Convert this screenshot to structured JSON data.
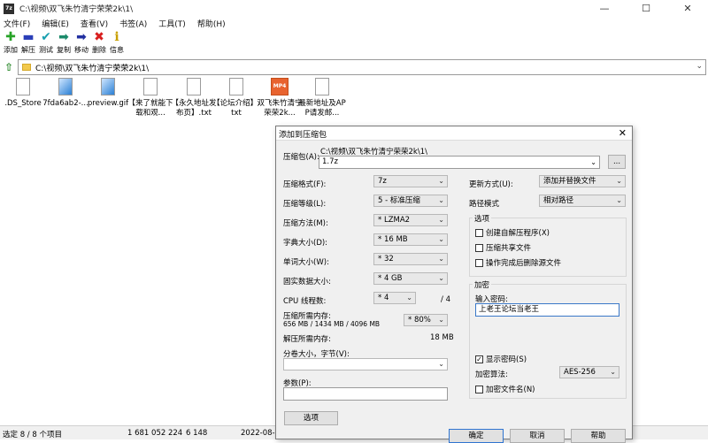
{
  "window": {
    "title": "C:\\视频\\双飞朱竹清宁荣荣2k\\1\\",
    "app_icon": "7z",
    "controls": {
      "minimize": "—",
      "maximize": "☐",
      "close": "✕"
    }
  },
  "menu": [
    "文件(F)",
    "编辑(E)",
    "查看(V)",
    "书签(A)",
    "工具(T)",
    "帮助(H)"
  ],
  "toolbar": [
    {
      "label": "添加",
      "icon": "add-icon",
      "glyph": "✚",
      "color": "#27a327"
    },
    {
      "label": "解压",
      "icon": "extract-icon",
      "glyph": "▬",
      "color": "#2b3fb8"
    },
    {
      "label": "测试",
      "icon": "test-icon",
      "glyph": "✔",
      "color": "#19a0b0"
    },
    {
      "label": "复制",
      "icon": "copy-icon",
      "glyph": "➡",
      "color": "#1a8a6a"
    },
    {
      "label": "移动",
      "icon": "move-icon",
      "glyph": "➡",
      "color": "#2230a0"
    },
    {
      "label": "删除",
      "icon": "delete-icon",
      "glyph": "✖",
      "color": "#d81e1e"
    },
    {
      "label": "信息",
      "icon": "info-icon",
      "glyph": "i",
      "color": "#c8a000"
    }
  ],
  "address": {
    "path": "C:\\视频\\双飞朱竹清宁荣荣2k\\1\\"
  },
  "files": [
    {
      "name": ".DS_Store",
      "type": "file"
    },
    {
      "name": "7fda6ab2-...",
      "type": "img"
    },
    {
      "name": "preview.gif",
      "type": "img"
    },
    {
      "name": "【来了就能下载和观...",
      "type": "file"
    },
    {
      "name": "【永久地址发布页】.txt",
      "type": "file"
    },
    {
      "name": "【论坛介绍】.txt",
      "type": "file"
    },
    {
      "name": "双飞朱竹清宁荣荣2k...",
      "type": "mp4"
    },
    {
      "name": "最新地址及APP请发邮...",
      "type": "file"
    }
  ],
  "status": {
    "selected": "选定 8 / 8 个项目",
    "size": "1 681 052 224",
    "packed": "6 148",
    "date": "2022-08-1"
  },
  "dialog": {
    "title": "添加到压缩包",
    "archive_label": "压缩包(A):",
    "archive_dir": "C:\\视频\\双飞朱竹清宁荣荣2k\\1\\",
    "archive_name": "1.7z",
    "browse": "...",
    "format_label": "压缩格式(F):",
    "format_value": "7z",
    "level_label": "压缩等级(L):",
    "level_value": "5 - 标准压缩",
    "method_label": "压缩方法(M):",
    "method_value": "* LZMA2",
    "dict_label": "字典大小(D):",
    "dict_value": "* 16 MB",
    "word_label": "单词大小(W):",
    "word_value": "* 32",
    "solid_label": "固实数据大小:",
    "solid_value": "* 4 GB",
    "cpu_label": "CPU 线程数:",
    "cpu_value": "* 4",
    "cpu_total": "/ 4",
    "mem_comp_label": "压缩所需内存:",
    "mem_comp_detail": "656 MB / 1434 MB / 4096 MB",
    "mem_comp_value": "* 80%",
    "mem_decomp_label": "解压所需内存:",
    "mem_decomp_value": "18 MB",
    "split_label": "分卷大小，字节(V):",
    "params_label": "参数(P):",
    "options_button": "选项",
    "update_label": "更新方式(U):",
    "update_value": "添加并替换文件",
    "path_label": "路径模式",
    "path_value": "相对路径",
    "options_group": "选项",
    "opt_sfx": "创建自解压程序(X)",
    "opt_shared": "压缩共享文件",
    "opt_delete": "操作完成后删除源文件",
    "enc_group": "加密",
    "password_label": "输入密码:",
    "password_value": "上老王论坛当老王",
    "show_password": "显示密码(S)",
    "enc_method_label": "加密算法:",
    "enc_method_value": "AES-256",
    "encrypt_names": "加密文件名(N)",
    "ok": "确定",
    "cancel": "取消",
    "help": "帮助"
  }
}
